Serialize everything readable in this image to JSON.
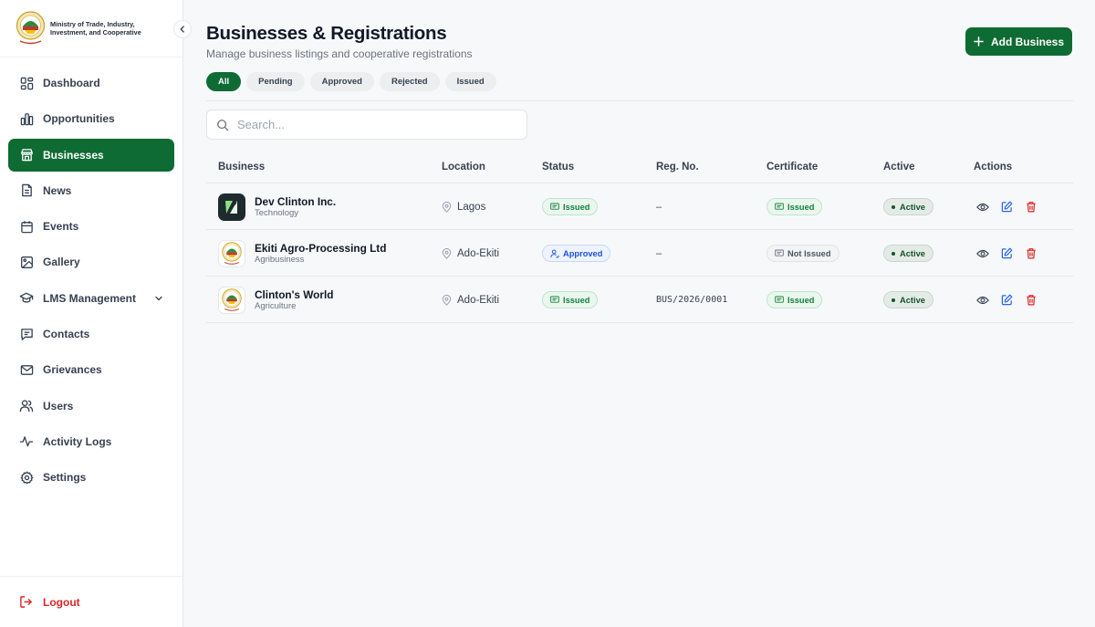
{
  "brand": {
    "name": "Ministry of Trade, Industry, Investment, and Cooperative"
  },
  "sidebar": {
    "items": [
      {
        "label": "Dashboard",
        "icon": "dashboard-icon"
      },
      {
        "label": "Opportunities",
        "icon": "bar-chart-icon"
      },
      {
        "label": "Businesses",
        "icon": "store-icon",
        "active": true
      },
      {
        "label": "News",
        "icon": "document-icon"
      },
      {
        "label": "Events",
        "icon": "calendar-icon"
      },
      {
        "label": "Gallery",
        "icon": "image-icon"
      },
      {
        "label": "LMS Management",
        "icon": "graduation-cap-icon",
        "expandable": true
      },
      {
        "label": "Contacts",
        "icon": "message-icon"
      },
      {
        "label": "Grievances",
        "icon": "mail-icon"
      },
      {
        "label": "Users",
        "icon": "users-icon"
      },
      {
        "label": "Activity Logs",
        "icon": "activity-icon"
      },
      {
        "label": "Settings",
        "icon": "gear-icon"
      }
    ],
    "logout_label": "Logout"
  },
  "header": {
    "title": "Businesses & Registrations",
    "subtitle": "Manage business listings and cooperative registrations",
    "add_button": "Add Business"
  },
  "tabs": [
    "All",
    "Pending",
    "Approved",
    "Rejected",
    "Issued"
  ],
  "active_tab": "All",
  "search": {
    "placeholder": "Search..."
  },
  "table": {
    "columns": [
      "Business",
      "Location",
      "Status",
      "Reg. No.",
      "Certificate",
      "Active",
      "Actions"
    ],
    "rows": [
      {
        "name": "Dev Clinton Inc.",
        "category": "Technology",
        "location": "Lagos",
        "status": "Issued",
        "reg_no": "–",
        "certificate": "Issued",
        "active": "Active"
      },
      {
        "name": "Ekiti Agro-Processing Ltd",
        "category": "Agribusiness",
        "location": "Ado-Ekiti",
        "status": "Approved",
        "reg_no": "–",
        "certificate": "Not Issued",
        "active": "Active"
      },
      {
        "name": "Clinton's World",
        "category": "Agriculture",
        "location": "Ado-Ekiti",
        "status": "Issued",
        "reg_no": "BUS/2026/0001",
        "certificate": "Issued",
        "active": "Active"
      }
    ]
  },
  "colors": {
    "brand_green": "#0f6b34",
    "danger": "#dc2626",
    "edit_blue": "#2563eb"
  }
}
